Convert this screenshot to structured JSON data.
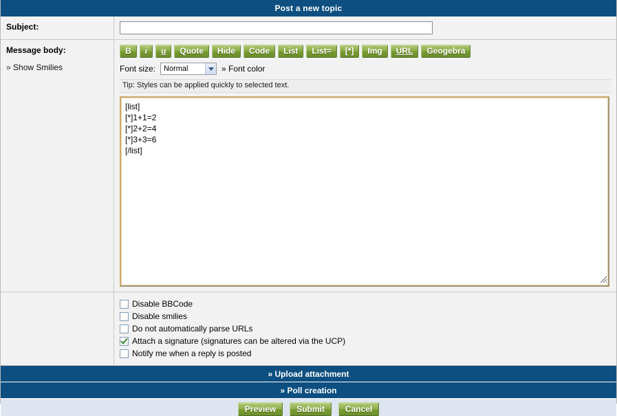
{
  "window": {
    "title": "Post a new topic"
  },
  "form": {
    "subject": {
      "label": "Subject:",
      "value": "",
      "placeholder": ""
    },
    "message": {
      "label": "Message body:",
      "show_smilies": "Show Smilies",
      "chevron": "»",
      "body_value": "[list]\n[*]1+1=2\n[*]2+2=4\n[*]3+3=6\n[/list]"
    }
  },
  "toolbar": {
    "buttons": [
      {
        "label": "B",
        "name": "bold-button",
        "style": "bold"
      },
      {
        "label": "i",
        "name": "italic-button",
        "style": "italic"
      },
      {
        "label": "u",
        "name": "underline-button",
        "style": "underline"
      },
      {
        "label": "Quote",
        "name": "quote-button",
        "style": "normal"
      },
      {
        "label": "Hide",
        "name": "hide-button",
        "style": "normal"
      },
      {
        "label": "Code",
        "name": "code-button",
        "style": "normal"
      },
      {
        "label": "List",
        "name": "list-button",
        "style": "normal"
      },
      {
        "label": "List=",
        "name": "list-ordered-button",
        "style": "normal"
      },
      {
        "label": "[*]",
        "name": "list-item-button",
        "style": "normal"
      },
      {
        "label": "Img",
        "name": "image-button",
        "style": "normal"
      },
      {
        "label": "URL",
        "name": "url-button",
        "style": "underline"
      },
      {
        "label": "Geogebra",
        "name": "geogebra-button",
        "style": "normal"
      }
    ],
    "font_size_label": "Font size:",
    "font_size_value": "Normal",
    "font_color_label": "Font color",
    "font_color_chevron": "»",
    "tip": "Tip: Styles can be applied quickly to selected text."
  },
  "options": [
    {
      "label": "Disable BBCode",
      "checked": false,
      "name": "disable-bbcode-checkbox"
    },
    {
      "label": "Disable smilies",
      "checked": false,
      "name": "disable-smilies-checkbox"
    },
    {
      "label": "Do not automatically parse URLs",
      "checked": false,
      "name": "disable-url-parse-checkbox"
    },
    {
      "label": "Attach a signature (signatures can be altered via the UCP)",
      "checked": true,
      "name": "attach-signature-checkbox"
    },
    {
      "label": "Notify me when a reply is posted",
      "checked": false,
      "name": "notify-reply-checkbox"
    }
  ],
  "sections": [
    {
      "label": "» Upload attachment",
      "name": "upload-attachment-bar"
    },
    {
      "label": "» Poll creation",
      "name": "poll-creation-bar"
    }
  ],
  "actions": [
    {
      "label": "Preview",
      "name": "preview-button"
    },
    {
      "label": "Submit",
      "name": "submit-button"
    },
    {
      "label": "Cancel",
      "name": "cancel-button"
    }
  ],
  "colors": {
    "header_blue": "#0d4f80",
    "button_green": "#8fb04f",
    "panel_gray": "#f2f2f2",
    "footer_blue_gray": "#dfe5f0",
    "textarea_border": "#cfa96a",
    "check_green": "#2f8a2f"
  }
}
